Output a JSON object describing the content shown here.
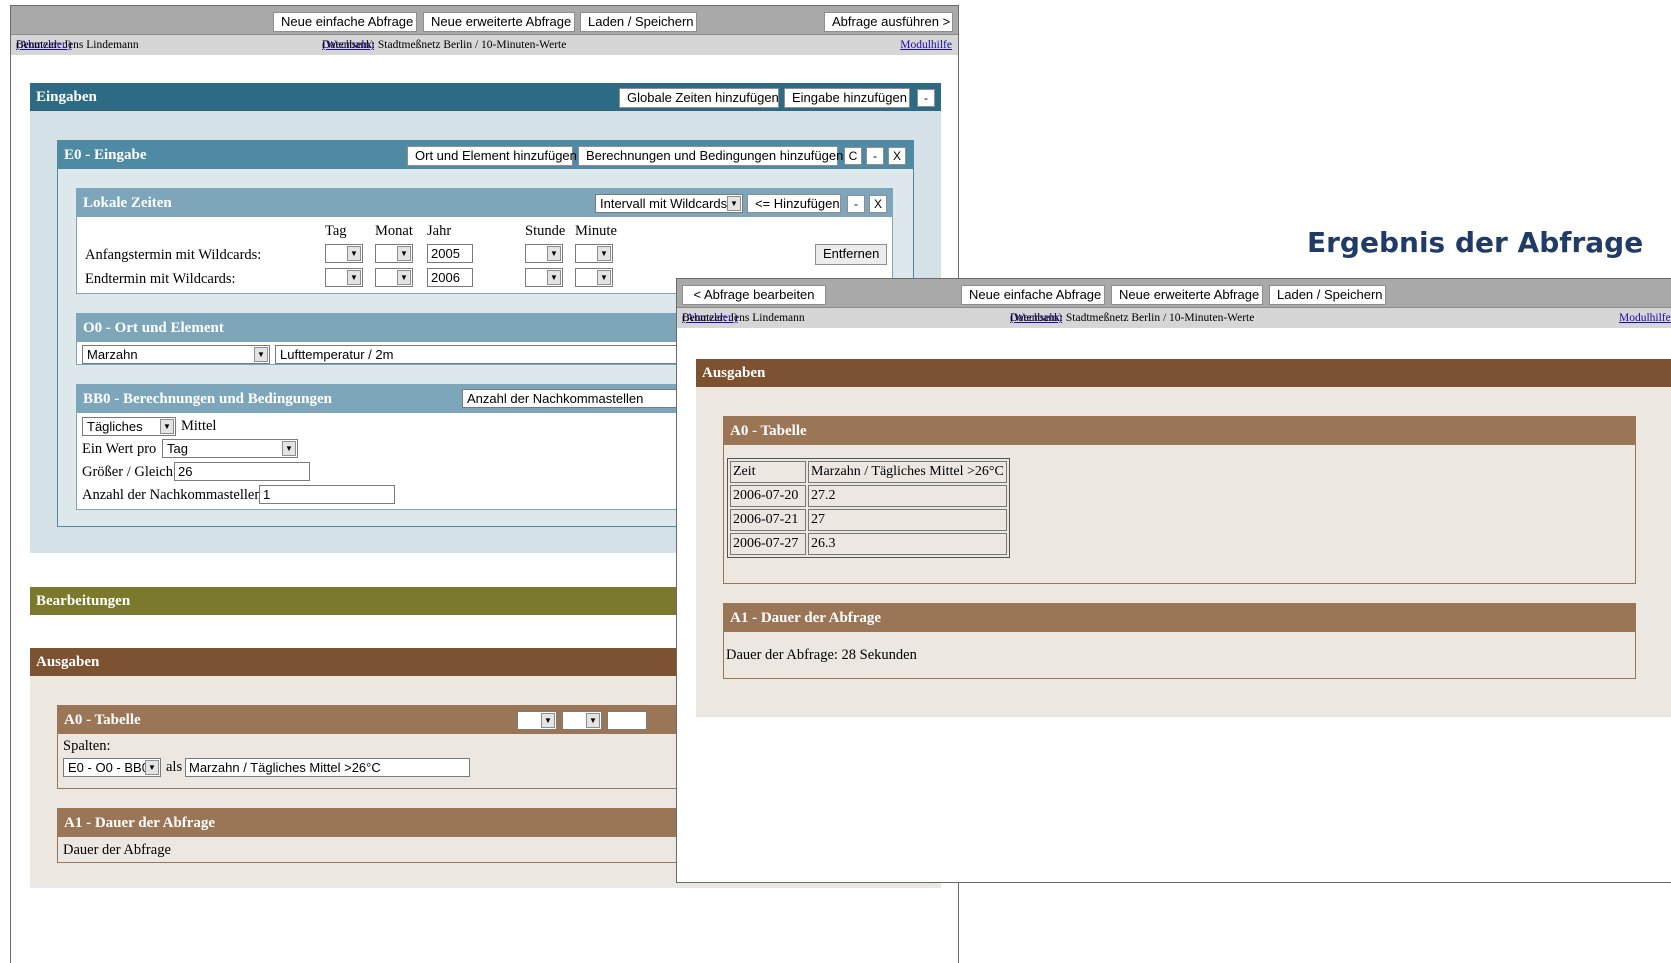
{
  "query_window": {
    "toolbar": {
      "new_simple": "Neue einfache Abfrage",
      "new_extended": "Neue erweiterte Abfrage",
      "load_save": "Laden / Speichern",
      "execute": "Abfrage ausführen >"
    },
    "subbar": {
      "user_prefix": "Benutzer: Jens Lindemann",
      "logout": "(Abmelden)",
      "db_prefix": "Datenbank: Stadtmeßnetz Berlin / 10-Minuten-Werte",
      "switch": "(Wechseln)",
      "help": "Modulhilfe"
    },
    "eingaben": {
      "title": "Eingaben",
      "add_global_times": "Globale Zeiten hinzufügen",
      "add_input": "Eingabe hinzufügen",
      "collapse": "-",
      "e0": {
        "title": "E0 - Eingabe",
        "add_place": "Ort und Element hinzufügen",
        "add_calc": "Berechnungen und Bedingungen hinzufügen",
        "btn_c": "C",
        "btn_minus": "-",
        "btn_x": "X",
        "local_times": {
          "title": "Lokale Zeiten",
          "mode_select": "Intervall mit Wildcards",
          "add": "<= Hinzufügen",
          "btn_minus": "-",
          "btn_x": "X",
          "col_tag": "Tag",
          "col_monat": "Monat",
          "col_jahr": "Jahr",
          "col_stunde": "Stunde",
          "col_minute": "Minute",
          "start_label": "Anfangstermin mit Wildcards:",
          "end_label": "Endtermin mit Wildcards:",
          "start_year": "2005",
          "end_year": "2006",
          "remove": "Entfernen"
        },
        "o0": {
          "title": "O0 - Ort und Element",
          "place": "Marzahn",
          "element": "Lufttemperatur / 2m"
        },
        "bb0": {
          "title": "BB0 - Berechnungen und Bedingungen",
          "selector": "Anzahl der Nachkommastellen",
          "agg": "Tägliches",
          "agg_suffix": "Mittel",
          "per_label": "Ein Wert pro",
          "per_value": "Tag",
          "ge_label": "Größer / Gleich",
          "ge_value": "26",
          "dec_label": "Anzahl der Nachkommastellen",
          "dec_value": "1"
        }
      }
    },
    "bearbeitungen": {
      "title": "Bearbeitungen"
    },
    "ausgaben": {
      "title": "Ausgaben",
      "a0": {
        "title": "A0 - Tabelle",
        "columns_label": "Spalten:",
        "column_select": "E0 - O0 - BB0",
        "as_label": "als",
        "column_name": "Marzahn / Tägliches Mittel >26°C"
      },
      "a1": {
        "title": "A1 - Dauer der Abfrage",
        "text": "Dauer der Abfrage"
      }
    }
  },
  "result_title": "Ergebnis der Abfrage",
  "result_window": {
    "toolbar": {
      "back": "< Abfrage bearbeiten",
      "new_simple": "Neue einfache Abfrage",
      "new_extended": "Neue erweiterte Abfrage",
      "load_save": "Laden / Speichern"
    },
    "subbar": {
      "user_prefix": "Benutzer: Jens Lindemann",
      "logout": "(Abmelden)",
      "db_prefix": "Datenbank: Stadtmeßnetz Berlin / 10-Minuten-Werte",
      "switch": "(Wechseln)",
      "help": "Modulhilfe"
    },
    "ausgaben": {
      "title": "Ausgaben",
      "a0": {
        "title": "A0 - Tabelle",
        "headers": [
          "Zeit",
          "Marzahn / Tägliches Mittel >26°C"
        ],
        "rows": [
          [
            "2006-07-20",
            "27.2"
          ],
          [
            "2006-07-21",
            "27"
          ],
          [
            "2006-07-27",
            "26.3"
          ]
        ]
      },
      "a1": {
        "title": "A1 - Dauer der Abfrage",
        "text": "Dauer der Abfrage: 28 Sekunden"
      }
    }
  },
  "colors": {
    "eingaben": "#2d6b85",
    "e0_header": "#4e8aa3",
    "sub_header": "#7ea6bb",
    "bearbeitungen": "#7b7a2c",
    "ausgaben": "#7c5230",
    "output_header": "#9a7656",
    "output_bg": "#ece7e1"
  }
}
